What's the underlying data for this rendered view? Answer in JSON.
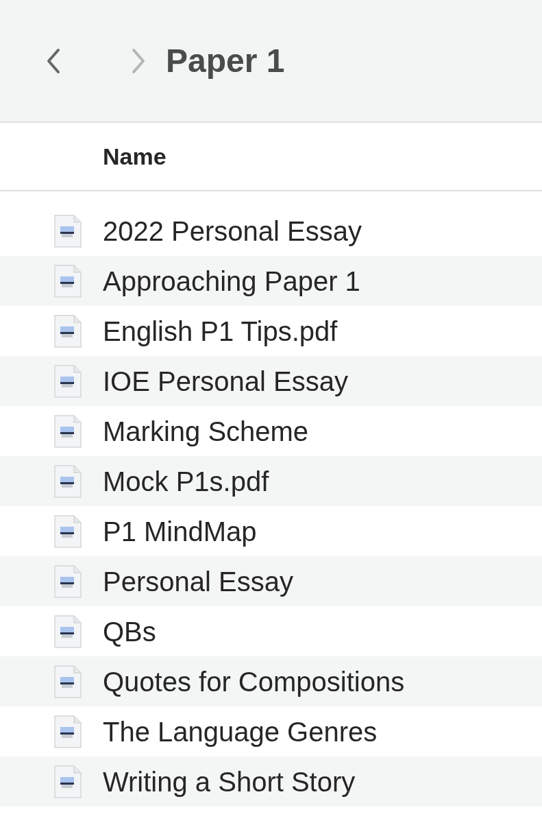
{
  "toolbar": {
    "back": {
      "disabled": false
    },
    "forward": {
      "disabled": true
    },
    "title": "Paper 1"
  },
  "table": {
    "columns": [
      "Name"
    ],
    "rows": [
      {
        "name": "2022 Personal Essay"
      },
      {
        "name": "Approaching Paper 1"
      },
      {
        "name": "English P1 Tips.pdf"
      },
      {
        "name": "IOE Personal Essay"
      },
      {
        "name": "Marking Scheme"
      },
      {
        "name": "Mock P1s.pdf"
      },
      {
        "name": "P1 MindMap"
      },
      {
        "name": "Personal Essay"
      },
      {
        "name": "QBs"
      },
      {
        "name": "Quotes for Compositions"
      },
      {
        "name": "The Language Genres"
      },
      {
        "name": "Writing a Short Story"
      }
    ]
  }
}
